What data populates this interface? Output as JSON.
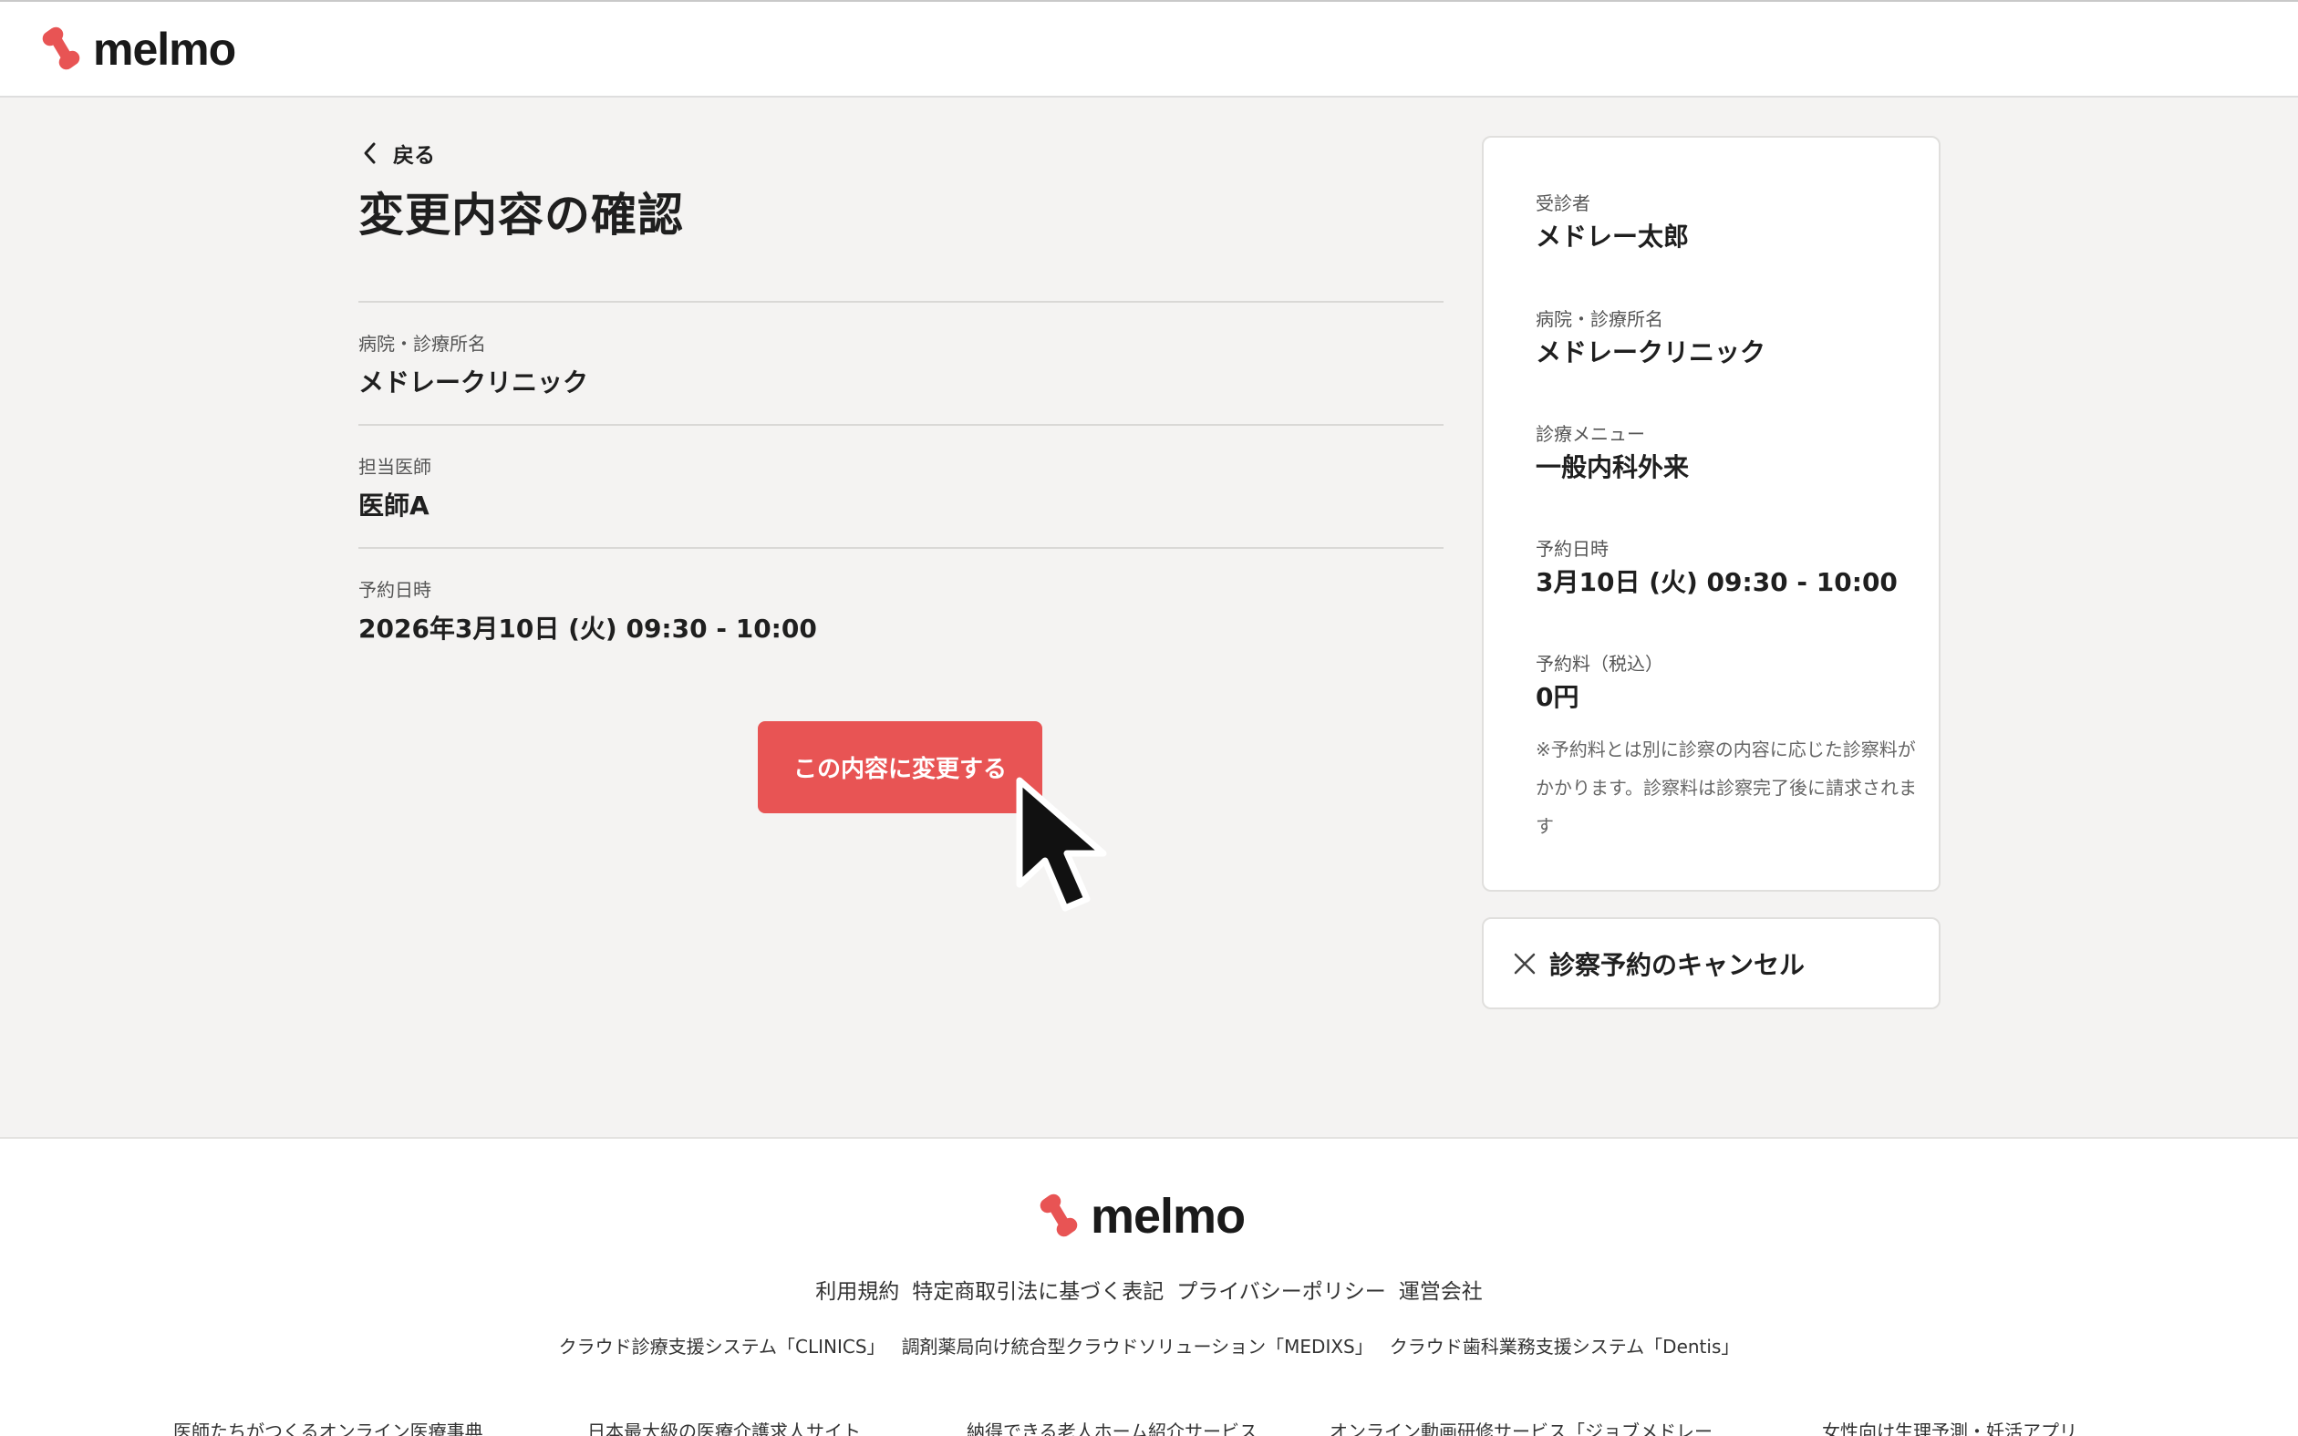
{
  "brand": {
    "name": "melmo",
    "accent": "#e85454"
  },
  "nav": {
    "back_label": "戻る"
  },
  "page": {
    "title": "変更内容の確認"
  },
  "details": {
    "clinic_label": "病院・診療所名",
    "clinic_value": "メドレークリニック",
    "doctor_label": "担当医師",
    "doctor_value": "医師A",
    "datetime_label": "予約日時",
    "datetime_value": "2026年3月10日 (火) 09:30 - 10:00"
  },
  "actions": {
    "confirm_label": "この内容に変更する",
    "cancel_label": "診察予約のキャンセル"
  },
  "summary": {
    "patient_label": "受診者",
    "patient_value": "メドレー太郎",
    "clinic_label": "病院・診療所名",
    "clinic_value": "メドレークリニック",
    "menu_label": "診療メニュー",
    "menu_value": "一般内科外来",
    "datetime_label": "予約日時",
    "datetime_value": "3月10日 (火) 09:30 - 10:00",
    "fee_label": "予約料（税込）",
    "fee_value": "0円",
    "note": "※予約料とは別に診察の内容に応じた診察料がかかります。診察料は診察完了後に請求されます"
  },
  "footer": {
    "links": [
      "利用規約",
      "特定商取引法に基づく表記",
      "プライバシーポリシー",
      "運営会社"
    ],
    "services": [
      "クラウド診療支援システム「CLINICS」",
      "調剤薬局向け統合型クラウドソリューション「MEDIXS」",
      "クラウド歯科業務支援システム「Dentis」"
    ],
    "row3": [
      "医師たちがつくるオンライン医療事典",
      "日本最大級の医療介護求人サイト",
      "納得できる老人ホーム紹介サービス",
      "オンライン動画研修サービス「ジョブメドレー",
      "女性向け生理予測・妊活アプリ"
    ]
  }
}
